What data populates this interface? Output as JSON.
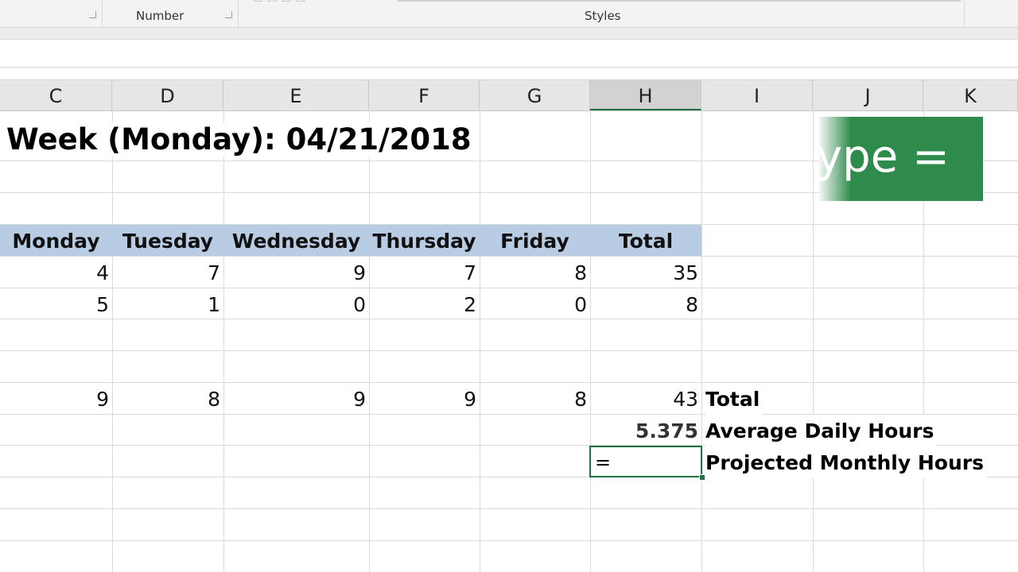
{
  "ribbon": {
    "number_group_label": "Number",
    "styles_group_label": "Styles"
  },
  "columns": [
    "C",
    "D",
    "E",
    "F",
    "G",
    "H",
    "I",
    "J",
    "K"
  ],
  "selected_column": "H",
  "sheet": {
    "title": "Week (Monday): 04/21/2018",
    "headers": [
      "Monday",
      "Tuesday",
      "Wednesday",
      "Thursday",
      "Friday",
      "Total"
    ],
    "rows": [
      [
        "4",
        "7",
        "9",
        "7",
        "8",
        "35"
      ],
      [
        "5",
        "1",
        "0",
        "2",
        "0",
        "8"
      ]
    ],
    "totals_row": [
      "9",
      "8",
      "9",
      "9",
      "8",
      "43"
    ],
    "totals_label": "Total",
    "average_value": "5.375",
    "average_label": "Average Daily Hours",
    "projected_label": "Projected Monthly Hours",
    "active_cell_value": "="
  },
  "overlay": {
    "text": "ype =",
    "color": "#2e8b4c"
  },
  "colors": {
    "header_band": "#b8cce4",
    "selection": "#217346"
  }
}
